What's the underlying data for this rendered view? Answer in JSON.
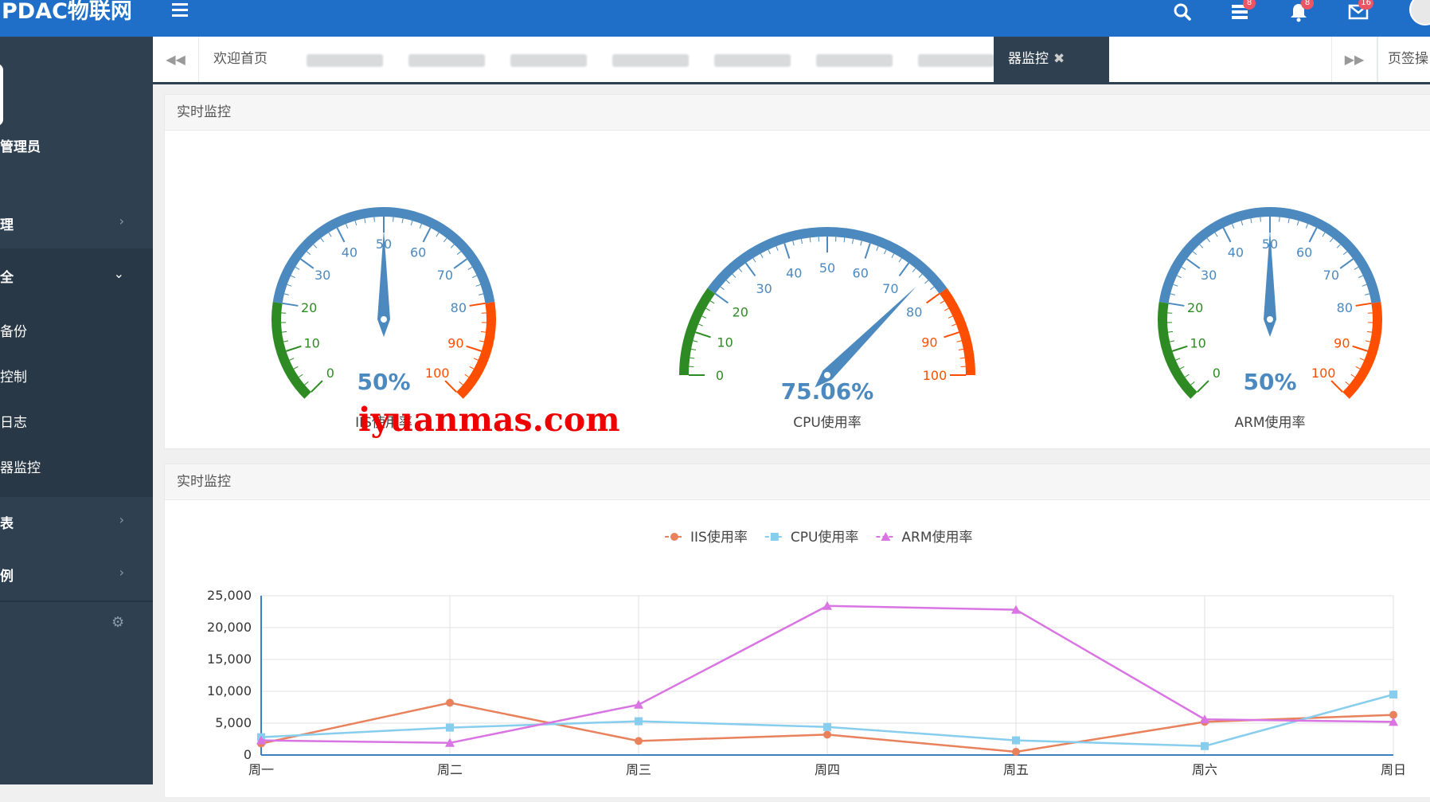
{
  "app": {
    "title": "PDAC物联网"
  },
  "header": {
    "icons": [
      {
        "name": "search-icon"
      },
      {
        "name": "tasks-icon",
        "badge": "8"
      },
      {
        "name": "bell-icon",
        "badge": "8"
      },
      {
        "name": "envelope-icon",
        "badge": "16"
      }
    ]
  },
  "sidebar": {
    "user": "管理员",
    "items": [
      {
        "label": "理",
        "chevron": "›"
      },
      {
        "label": "全",
        "chevron": "⌄"
      },
      {
        "label": "表",
        "chevron": "›"
      },
      {
        "label": "例",
        "chevron": "›"
      }
    ],
    "sub_items": [
      "备份",
      "控制",
      "日志",
      "器监控"
    ]
  },
  "tabs": {
    "prev": "◀◀",
    "next": "▶▶",
    "items": [
      "欢迎首页",
      "",
      "",
      "",
      "",
      "",
      "",
      "",
      "器监控"
    ],
    "close": "✖",
    "ops": "页签操作"
  },
  "panels": {
    "gauges_title": "实时监控",
    "chart_title": "实时监控"
  },
  "gauges": [
    {
      "label": "IIS使用率",
      "value": 50,
      "display": "50%",
      "ticks": [
        "0",
        "10",
        "20",
        "30",
        "40",
        "50",
        "60",
        "70",
        "80",
        "90",
        "100"
      ]
    },
    {
      "label": "CPU使用率",
      "value": 75.06,
      "display": "75.06%",
      "ticks": [
        "0",
        "10",
        "20",
        "30",
        "40",
        "50",
        "60",
        "70",
        "80",
        "90",
        "100"
      ]
    },
    {
      "label": "ARM使用率",
      "value": 50,
      "display": "50%",
      "ticks": [
        "0",
        "10",
        "20",
        "30",
        "40",
        "50",
        "60",
        "70",
        "80",
        "90",
        "100"
      ]
    }
  ],
  "colors": {
    "gauge_low": "#2e8b23",
    "gauge_mid": "#4b89bf",
    "gauge_high": "#ff4e00",
    "iis": "#e8825c",
    "cpu": "#87cdee",
    "arm": "#d975e2"
  },
  "chart_data": {
    "type": "line",
    "categories": [
      "周一",
      "周二",
      "周三",
      "周四",
      "周五",
      "周六",
      "周日"
    ],
    "series": [
      {
        "name": "IIS使用率",
        "values": [
          1800,
          8200,
          2200,
          3200,
          500,
          5200,
          6300
        ]
      },
      {
        "name": "CPU使用率",
        "values": [
          2800,
          4300,
          5300,
          4400,
          2300,
          1400,
          9500
        ]
      },
      {
        "name": "ARM使用率",
        "values": [
          2300,
          1900,
          7900,
          23400,
          22800,
          5600,
          5200
        ]
      }
    ],
    "y_ticks": [
      "25,000",
      "20,000",
      "15,000",
      "10,000",
      "5,000",
      "0"
    ],
    "ylim": [
      0,
      25000
    ],
    "legend": "top-center",
    "grid": true
  },
  "watermark": "iyuanmas.com"
}
